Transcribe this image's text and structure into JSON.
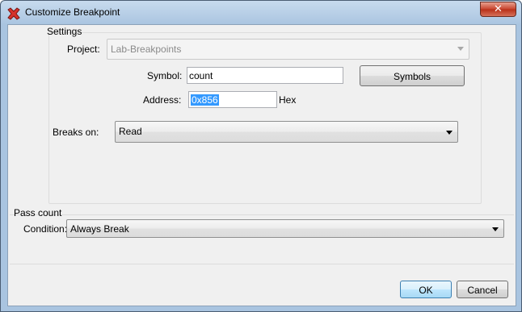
{
  "window": {
    "title": "Customize Breakpoint",
    "close_glyph": "✕",
    "icon": "red-x-breakpoint-icon"
  },
  "settings": {
    "legend": "Settings",
    "project_label": "Project:",
    "project_value": "Lab-Breakpoints",
    "symbol_label": "Symbol:",
    "symbol_value": "count",
    "symbols_button": "Symbols",
    "address_label": "Address:",
    "address_value": "0x856",
    "address_unit": "Hex",
    "breaks_on_label": "Breaks on:",
    "breaks_on_value": "Read"
  },
  "pass_count": {
    "legend": "Pass count",
    "condition_label": "Condition:",
    "condition_value": "Always Break"
  },
  "footer": {
    "ok_label": "OK",
    "cancel_label": "Cancel"
  },
  "colors": {
    "title_bar": "#a9c4e0",
    "close_button": "#c7432c",
    "selection": "#3399ff",
    "dialog_bg": "#f0f0f0"
  }
}
